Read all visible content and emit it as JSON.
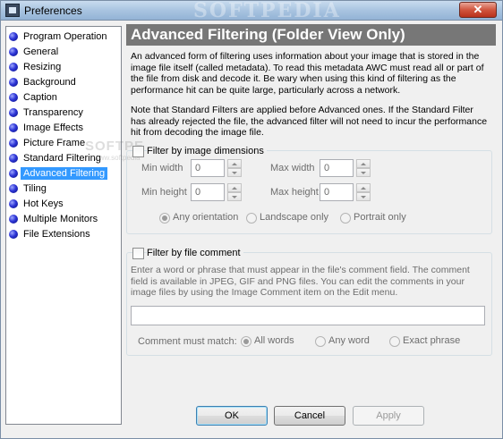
{
  "window": {
    "title": "Preferences",
    "watermark": "SOFTPEDIA",
    "close_glyph": "✕"
  },
  "nav": {
    "items": [
      {
        "label": "Program Operation"
      },
      {
        "label": "General"
      },
      {
        "label": "Resizing"
      },
      {
        "label": "Background"
      },
      {
        "label": "Caption"
      },
      {
        "label": "Transparency"
      },
      {
        "label": "Image Effects"
      },
      {
        "label": "Picture Frame"
      },
      {
        "label": "Standard Filtering"
      },
      {
        "label": "Advanced Filtering",
        "selected": true
      },
      {
        "label": "Tiling"
      },
      {
        "label": "Hot Keys"
      },
      {
        "label": "Multiple Monitors"
      },
      {
        "label": "File Extensions"
      }
    ],
    "watermark": "SOFTPE",
    "watermark_sub": "www.softpedia"
  },
  "panel": {
    "title": "Advanced Filtering (Folder View Only)",
    "intro_1": "An advanced form of filtering uses information about your image that is stored in the image file itself (called metadata). To read this metadata AWC must read all or part of the file from disk and decode it. Be wary when using this kind of filtering as the performance hit can be quite large, particularly across a network.",
    "intro_2": "Note that Standard Filters are applied before Advanced ones. If the Standard Filter has already rejected the file, the advanced filter will not need to incur the performance hit from decoding the image file."
  },
  "dimensions": {
    "checkbox_label": "Filter by image dimensions",
    "min_width_label": "Min width",
    "min_width_value": "0",
    "max_width_label": "Max width",
    "max_width_value": "0",
    "min_height_label": "Min height",
    "min_height_value": "0",
    "max_height_label": "Max height",
    "max_height_value": "0",
    "orientation": {
      "options": [
        "Any orientation",
        "Landscape only",
        "Portrait only"
      ],
      "selected": "Any orientation"
    }
  },
  "comment": {
    "checkbox_label": "Filter by file comment",
    "description": "Enter a word or phrase that must appear in the file's comment field. The comment field is available in JPEG, GIF and PNG files. You can edit the comments in your image files by using the Image Comment item on the Edit menu.",
    "input_value": "",
    "match_label": "Comment must match:",
    "match": {
      "options": [
        "All words",
        "Any word",
        "Exact phrase"
      ],
      "selected": "All words"
    }
  },
  "buttons": {
    "ok": "OK",
    "cancel": "Cancel",
    "apply": "Apply"
  }
}
